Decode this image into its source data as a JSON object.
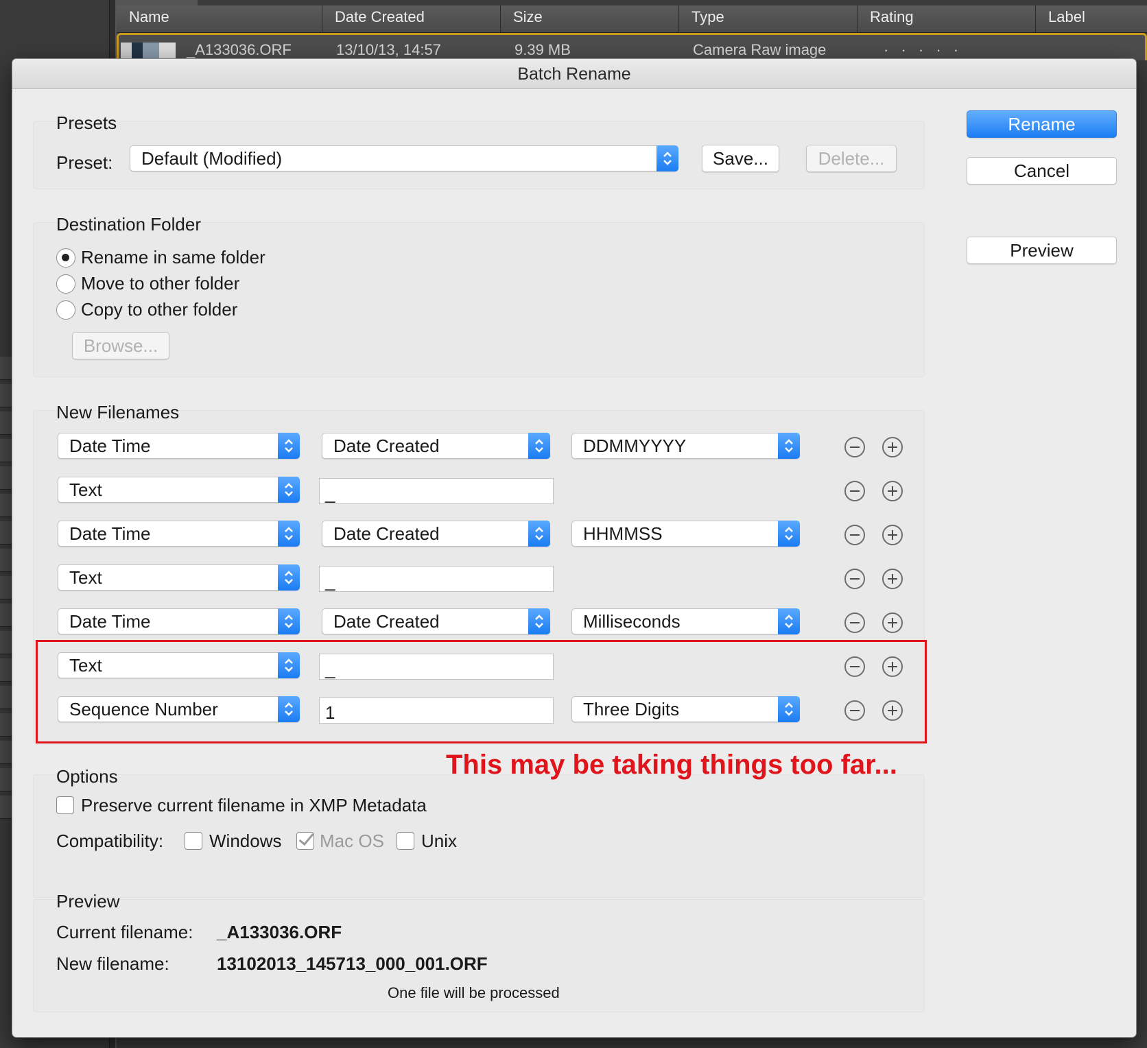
{
  "background": {
    "columns": [
      "Name",
      "Date Created",
      "Size",
      "Type",
      "Rating",
      "Label"
    ],
    "row": {
      "name": "_A133036.ORF",
      "date_created": "13/10/13, 14:57",
      "size": "9.39 MB",
      "type": "Camera Raw image",
      "rating": "· · · · ·"
    }
  },
  "dialog": {
    "title": "Batch Rename",
    "buttons": {
      "rename": "Rename",
      "cancel": "Cancel",
      "preview": "Preview"
    },
    "presets": {
      "title": "Presets",
      "preset_label": "Preset:",
      "preset_value": "Default (Modified)",
      "save": "Save...",
      "delete": "Delete..."
    },
    "destination": {
      "title": "Destination Folder",
      "options": [
        "Rename in same folder",
        "Move to other folder",
        "Copy to other folder"
      ],
      "selected_index": 0,
      "browse": "Browse..."
    },
    "new_filenames": {
      "title": "New Filenames",
      "rows": [
        {
          "type": "Date Time",
          "field": "Date Created",
          "format": "DDMMYYYY"
        },
        {
          "type": "Text",
          "text": "_"
        },
        {
          "type": "Date Time",
          "field": "Date Created",
          "format": "HHMMSS"
        },
        {
          "type": "Text",
          "text": "_"
        },
        {
          "type": "Date Time",
          "field": "Date Created",
          "format": "Milliseconds"
        },
        {
          "type": "Text",
          "text": "_"
        },
        {
          "type": "Sequence Number",
          "text": "1",
          "format": "Three Digits"
        }
      ]
    },
    "annotation": "This may be taking things too far...",
    "options": {
      "title": "Options",
      "preserve_label": "Preserve current filename in XMP Metadata",
      "preserve_checked": false,
      "compat_label": "Compatibility:",
      "windows": "Windows",
      "macos": "Mac OS",
      "unix": "Unix",
      "windows_checked": false,
      "macos_checked": true,
      "unix_checked": false
    },
    "preview": {
      "title": "Preview",
      "current_label": "Current filename:",
      "current_value": "_A133036.ORF",
      "new_label": "New filename:",
      "new_value": "13102013_145713_000_001.ORF",
      "status": "One file will be processed"
    }
  }
}
